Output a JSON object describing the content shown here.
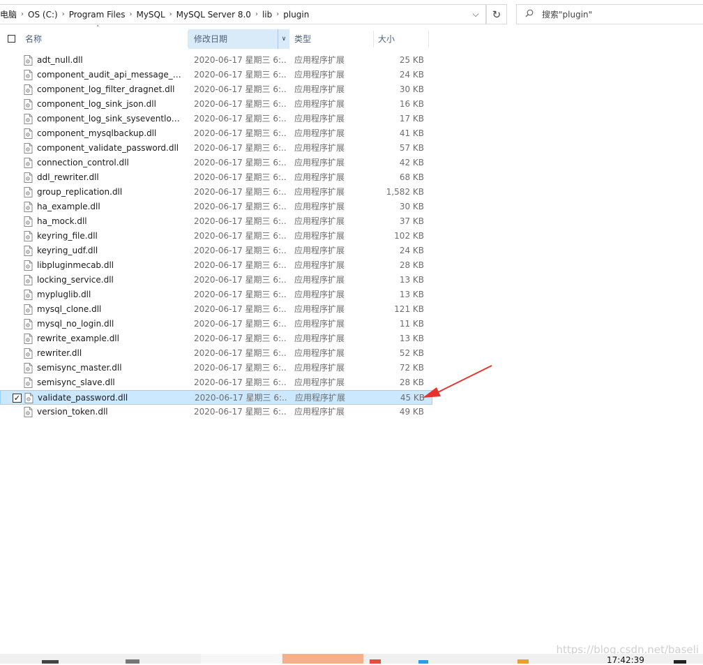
{
  "address": {
    "crumbs": [
      "电脑",
      "OS (C:)",
      "Program Files",
      "MySQL",
      "MySQL Server 8.0",
      "lib",
      "plugin"
    ]
  },
  "search": {
    "placeholder": "搜索\"plugin\""
  },
  "columns": {
    "name": "名称",
    "date": "修改日期",
    "type": "类型",
    "size": "大小"
  },
  "files": [
    {
      "name": "adt_null.dll",
      "date": "2020-06-17 星期三 6:...",
      "type": "应用程序扩展",
      "size": "25 KB"
    },
    {
      "name": "component_audit_api_message_e...",
      "date": "2020-06-17 星期三 6:...",
      "type": "应用程序扩展",
      "size": "24 KB"
    },
    {
      "name": "component_log_filter_dragnet.dll",
      "date": "2020-06-17 星期三 6:...",
      "type": "应用程序扩展",
      "size": "30 KB"
    },
    {
      "name": "component_log_sink_json.dll",
      "date": "2020-06-17 星期三 6:...",
      "type": "应用程序扩展",
      "size": "16 KB"
    },
    {
      "name": "component_log_sink_syseventlog.dll",
      "date": "2020-06-17 星期三 6:...",
      "type": "应用程序扩展",
      "size": "17 KB"
    },
    {
      "name": "component_mysqlbackup.dll",
      "date": "2020-06-17 星期三 6:...",
      "type": "应用程序扩展",
      "size": "41 KB"
    },
    {
      "name": "component_validate_password.dll",
      "date": "2020-06-17 星期三 6:...",
      "type": "应用程序扩展",
      "size": "57 KB"
    },
    {
      "name": "connection_control.dll",
      "date": "2020-06-17 星期三 6:...",
      "type": "应用程序扩展",
      "size": "42 KB"
    },
    {
      "name": "ddl_rewriter.dll",
      "date": "2020-06-17 星期三 6:...",
      "type": "应用程序扩展",
      "size": "68 KB"
    },
    {
      "name": "group_replication.dll",
      "date": "2020-06-17 星期三 6:...",
      "type": "应用程序扩展",
      "size": "1,582 KB"
    },
    {
      "name": "ha_example.dll",
      "date": "2020-06-17 星期三 6:...",
      "type": "应用程序扩展",
      "size": "30 KB"
    },
    {
      "name": "ha_mock.dll",
      "date": "2020-06-17 星期三 6:...",
      "type": "应用程序扩展",
      "size": "37 KB"
    },
    {
      "name": "keyring_file.dll",
      "date": "2020-06-17 星期三 6:...",
      "type": "应用程序扩展",
      "size": "102 KB"
    },
    {
      "name": "keyring_udf.dll",
      "date": "2020-06-17 星期三 6:...",
      "type": "应用程序扩展",
      "size": "24 KB"
    },
    {
      "name": "libpluginmecab.dll",
      "date": "2020-06-17 星期三 6:...",
      "type": "应用程序扩展",
      "size": "28 KB"
    },
    {
      "name": "locking_service.dll",
      "date": "2020-06-17 星期三 6:...",
      "type": "应用程序扩展",
      "size": "13 KB"
    },
    {
      "name": "mypluglib.dll",
      "date": "2020-06-17 星期三 6:...",
      "type": "应用程序扩展",
      "size": "13 KB"
    },
    {
      "name": "mysql_clone.dll",
      "date": "2020-06-17 星期三 6:...",
      "type": "应用程序扩展",
      "size": "121 KB"
    },
    {
      "name": "mysql_no_login.dll",
      "date": "2020-06-17 星期三 6:...",
      "type": "应用程序扩展",
      "size": "11 KB"
    },
    {
      "name": "rewrite_example.dll",
      "date": "2020-06-17 星期三 6:...",
      "type": "应用程序扩展",
      "size": "13 KB"
    },
    {
      "name": "rewriter.dll",
      "date": "2020-06-17 星期三 6:...",
      "type": "应用程序扩展",
      "size": "52 KB"
    },
    {
      "name": "semisync_master.dll",
      "date": "2020-06-17 星期三 6:...",
      "type": "应用程序扩展",
      "size": "72 KB"
    },
    {
      "name": "semisync_slave.dll",
      "date": "2020-06-17 星期三 6:...",
      "type": "应用程序扩展",
      "size": "28 KB"
    },
    {
      "name": "validate_password.dll",
      "date": "2020-06-17 星期三 6:...",
      "type": "应用程序扩展",
      "size": "45 KB",
      "selected": true
    },
    {
      "name": "version_token.dll",
      "date": "2020-06-17 星期三 6:...",
      "type": "应用程序扩展",
      "size": "49 KB"
    }
  ],
  "icons": {
    "file": "dll-file-icon",
    "search": "search-icon",
    "refresh": "refresh-icon",
    "dropdown": "chevron-down-icon",
    "separator": "chevron-right-icon"
  },
  "colors": {
    "selected_bg": "#cce8ff",
    "selected_border": "#99d1ff",
    "header_active": "#d9ebf9",
    "annotation_arrow": "#e8322d"
  },
  "watermark": "https://blog.csdn.net/baseli",
  "taskbar": {
    "clock": "17:42:39"
  }
}
